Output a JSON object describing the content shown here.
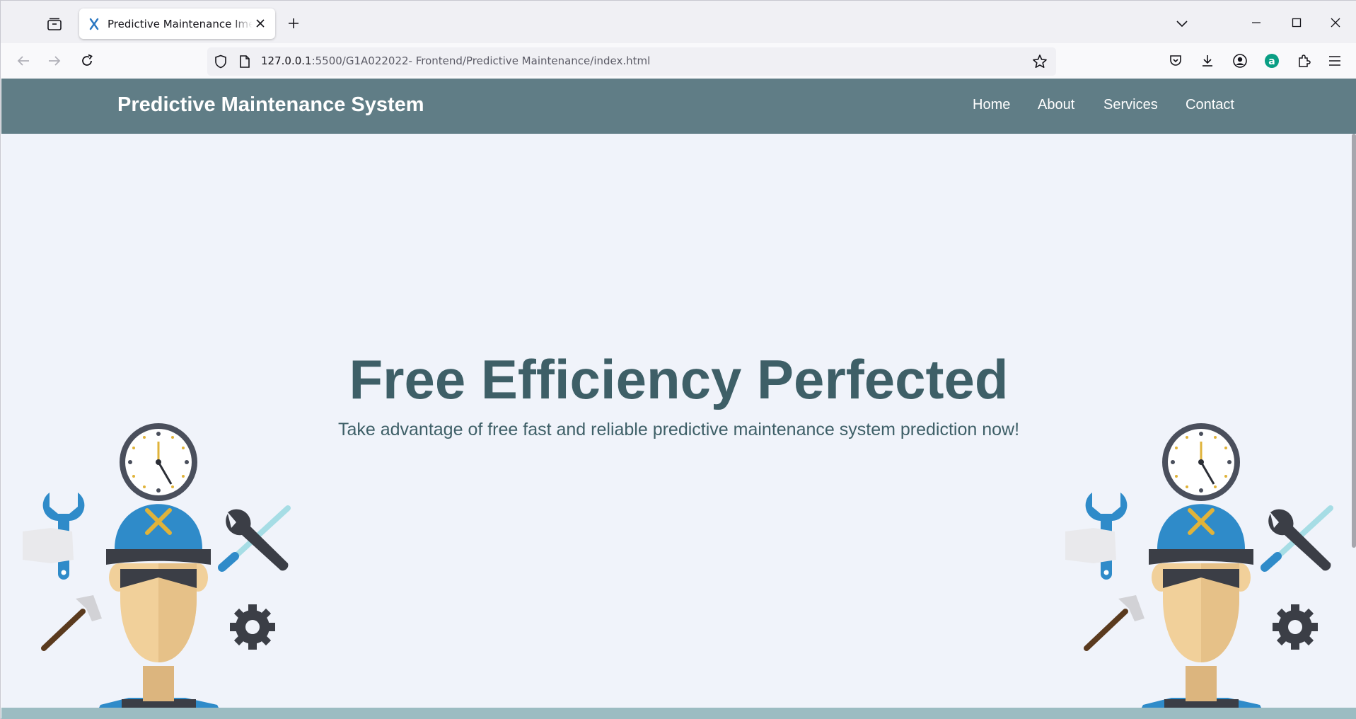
{
  "browser": {
    "tab": {
      "title": "Predictive Maintenance Imelda"
    },
    "url": {
      "host": "127.0.0.1",
      "rest": ":5500/G1A022022- Frontend/Predictive Maintenance/index.html"
    },
    "toolbar_icons": [
      "pocket-icon",
      "download-icon",
      "account-icon",
      "extension-a-icon",
      "extensions-icon",
      "menu-icon"
    ],
    "accent_color": "#0a9e84"
  },
  "site": {
    "brand": "Predictive Maintenance System",
    "nav": [
      "Home",
      "About",
      "Services",
      "Contact"
    ],
    "header_color": "#607d86",
    "text_color": "#3e5f67"
  },
  "hero": {
    "title": "Free Efficiency Perfected",
    "subtitle": "Take advantage of free fast and reliable predictive maintenance system prediction now!"
  }
}
